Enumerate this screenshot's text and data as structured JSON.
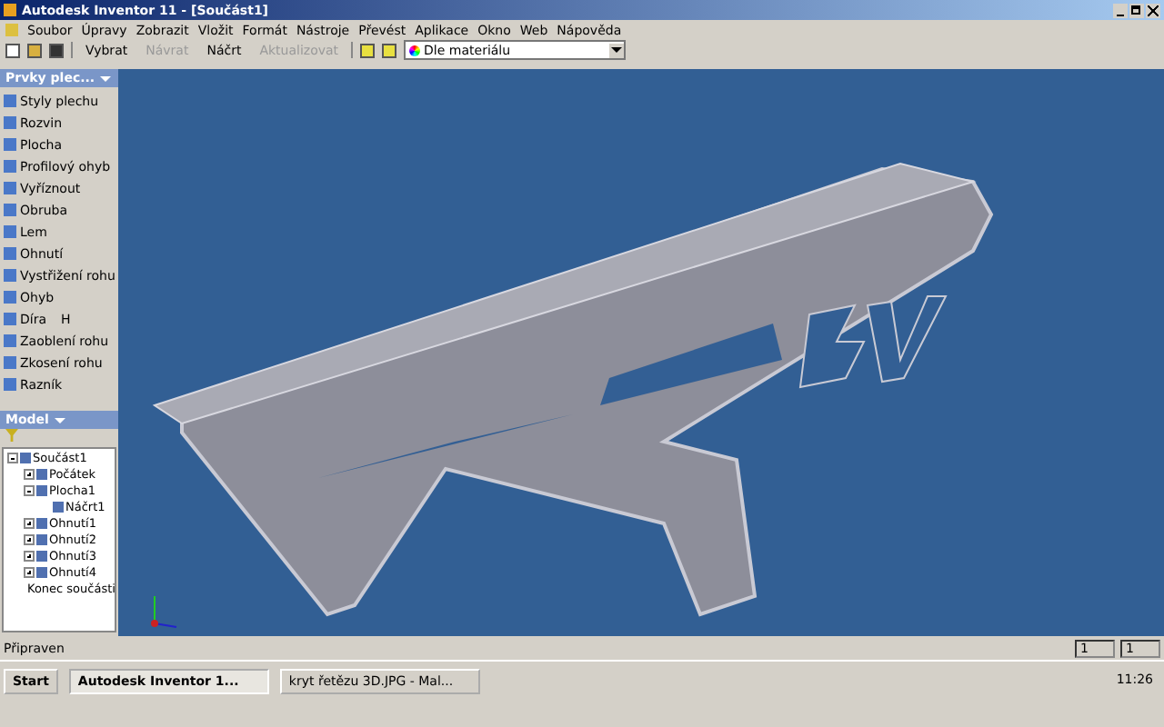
{
  "window": {
    "title": "Autodesk Inventor 11 - [Součást1]"
  },
  "menu": [
    "Soubor",
    "Úpravy",
    "Zobrazit",
    "Vložit",
    "Formát",
    "Nástroje",
    "Převést",
    "Aplikace",
    "Okno",
    "Web",
    "Nápověda"
  ],
  "toolbar": [
    {
      "label": "Vybrat",
      "disabled": false
    },
    {
      "label": "Návrat",
      "disabled": true
    },
    {
      "label": "Náčrt",
      "disabled": false
    },
    {
      "label": "Aktualizovat",
      "disabled": true
    }
  ],
  "material": {
    "value": "Dle materiálu"
  },
  "features_panel": {
    "title": "Prvky plec...",
    "items": [
      {
        "label": "Styly plechu"
      },
      {
        "label": "Rozvin"
      },
      {
        "label": "Plocha"
      },
      {
        "label": "Profilový ohyb"
      },
      {
        "label": "Vyříznout"
      },
      {
        "label": "Obruba"
      },
      {
        "label": "Lem"
      },
      {
        "label": "Ohnutí"
      },
      {
        "label": "Vystřižení rohu"
      },
      {
        "label": "Ohyb"
      },
      {
        "label": "Díra",
        "shortcut": "H"
      },
      {
        "label": "Zaoblení rohu"
      },
      {
        "label": "Zkosení rohu"
      },
      {
        "label": "Razník"
      }
    ]
  },
  "model_panel": {
    "title": "Model",
    "tree": [
      {
        "label": "Součást1",
        "expanded": true,
        "children": [
          {
            "label": "Počátek",
            "expanded": false
          },
          {
            "label": "Plocha1",
            "expanded": true,
            "children": [
              {
                "label": "Náčrt1"
              }
            ]
          },
          {
            "label": "Ohnutí1",
            "expanded": false
          },
          {
            "label": "Ohnutí2",
            "expanded": false
          },
          {
            "label": "Ohnutí3",
            "expanded": false
          },
          {
            "label": "Ohnutí4",
            "expanded": false
          },
          {
            "label": "Konec součásti"
          }
        ]
      }
    ]
  },
  "status_bar": {
    "text": "Připraven",
    "fields": [
      "1",
      "1"
    ]
  },
  "taskbar": {
    "start": "Start",
    "tasks": [
      {
        "label": "Autodesk Inventor 1...",
        "selected": true
      },
      {
        "label": "kryt řetězu 3D.JPG - Mal...",
        "selected": false
      }
    ],
    "clock": "11:26"
  }
}
